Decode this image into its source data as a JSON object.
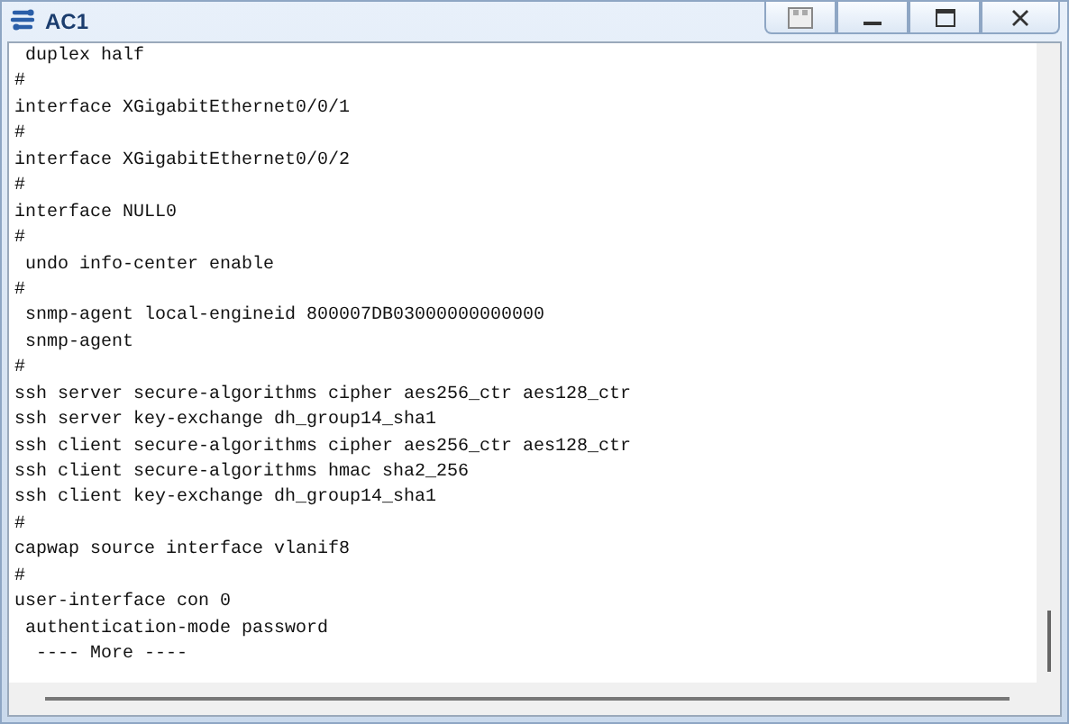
{
  "window": {
    "title": "AC1"
  },
  "console": {
    "lines": [
      " duplex half",
      "#",
      "interface XGigabitEthernet0/0/1",
      "#",
      "interface XGigabitEthernet0/0/2",
      "#",
      "interface NULL0",
      "#",
      " undo info-center enable",
      "#",
      " snmp-agent local-engineid 800007DB03000000000000",
      " snmp-agent",
      "#",
      "ssh server secure-algorithms cipher aes256_ctr aes128_ctr",
      "ssh server key-exchange dh_group14_sha1",
      "ssh client secure-algorithms cipher aes256_ctr aes128_ctr",
      "ssh client secure-algorithms hmac sha2_256",
      "ssh client key-exchange dh_group14_sha1",
      "#",
      "capwap source interface vlanif8",
      "#",
      "user-interface con 0",
      " authentication-mode password",
      "  ---- More ----"
    ]
  }
}
